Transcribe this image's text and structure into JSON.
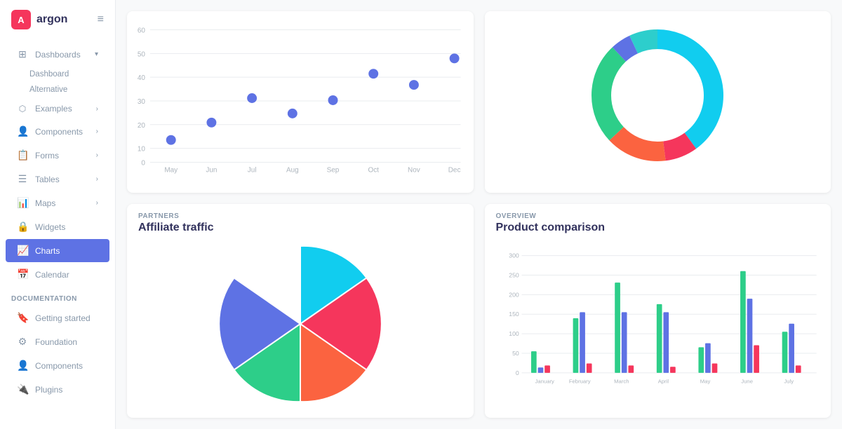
{
  "app": {
    "logo": "A",
    "name": "argon"
  },
  "sidebar": {
    "toggle_icon": "≡",
    "nav_sections": [
      {
        "items": [
          {
            "id": "dashboards",
            "label": "Dashboards",
            "icon": "⊞",
            "has_arrow": true,
            "has_children": true,
            "children": [
              {
                "label": "Dashboard"
              },
              {
                "label": "Alternative"
              }
            ]
          },
          {
            "id": "examples",
            "label": "Examples",
            "icon": "🔲",
            "has_arrow": true
          },
          {
            "id": "components",
            "label": "Components",
            "icon": "👤",
            "has_arrow": true
          },
          {
            "id": "forms",
            "label": "Forms",
            "icon": "📋",
            "has_arrow": true
          },
          {
            "id": "tables",
            "label": "Tables",
            "icon": "☰",
            "has_arrow": true
          },
          {
            "id": "maps",
            "label": "Maps",
            "icon": "📊",
            "has_arrow": true
          },
          {
            "id": "widgets",
            "label": "Widgets",
            "icon": "🔒"
          },
          {
            "id": "charts",
            "label": "Charts",
            "icon": "📅",
            "active": true
          },
          {
            "id": "calendar",
            "label": "Calendar",
            "icon": "📅"
          }
        ]
      }
    ],
    "doc_section": {
      "label": "DOCUMENTATION",
      "items": [
        {
          "id": "getting-started",
          "label": "Getting started",
          "icon": "🔖"
        },
        {
          "id": "foundation",
          "label": "Foundation",
          "icon": "⚙"
        },
        {
          "id": "doc-components",
          "label": "Components",
          "icon": "👤"
        },
        {
          "id": "plugins",
          "label": "Plugins",
          "icon": "🔌"
        }
      ]
    }
  },
  "charts": {
    "scatter": {
      "subtitle": "",
      "title": "",
      "x_labels": [
        "May",
        "Jun",
        "Jul",
        "Aug",
        "Sep",
        "Oct",
        "Nov",
        "Dec"
      ],
      "y_labels": [
        "0",
        "10",
        "20",
        "30",
        "40",
        "50",
        "60"
      ],
      "points": [
        {
          "x": 0,
          "y": 10
        },
        {
          "x": 1,
          "y": 18
        },
        {
          "x": 2,
          "y": 29
        },
        {
          "x": 3,
          "y": 22
        },
        {
          "x": 4,
          "y": 28
        },
        {
          "x": 5,
          "y": 40
        },
        {
          "x": 6,
          "y": 35
        },
        {
          "x": 7,
          "y": 47
        }
      ]
    },
    "donut": {
      "segments": [
        {
          "label": "Cyan",
          "color": "#11cdef",
          "value": 40
        },
        {
          "label": "Red",
          "color": "#f5365c",
          "value": 8
        },
        {
          "label": "Orange",
          "color": "#fb6340",
          "value": 15
        },
        {
          "label": "Green",
          "color": "#2dce89",
          "value": 25
        },
        {
          "label": "Purple",
          "color": "#5e72e4",
          "value": 5
        },
        {
          "label": "Teal",
          "color": "#2dcecc",
          "value": 7
        }
      ]
    },
    "affiliate": {
      "subtitle": "PARTNERS",
      "title": "Affiliate traffic",
      "segments": [
        {
          "label": "Cyan",
          "color": "#11cdef",
          "value": 15
        },
        {
          "label": "Red",
          "color": "#f5365c",
          "value": 25
        },
        {
          "label": "Orange",
          "color": "#fb6340",
          "value": 20
        },
        {
          "label": "Green",
          "color": "#2dce89",
          "value": 15
        },
        {
          "label": "Purple",
          "color": "#5e72e4",
          "value": 25
        }
      ]
    },
    "bar": {
      "subtitle": "OVERVIEW",
      "title": "Product comparison",
      "x_labels": [
        "January",
        "February",
        "March",
        "April",
        "May",
        "June",
        "July"
      ],
      "y_labels": [
        "0",
        "50",
        "100",
        "150",
        "200",
        "250",
        "300"
      ],
      "series": [
        {
          "color": "#2dce89",
          "values": [
            55,
            140,
            230,
            175,
            65,
            260,
            105
          ]
        },
        {
          "color": "#5e72e4",
          "values": [
            15,
            155,
            155,
            155,
            75,
            190,
            125
          ]
        },
        {
          "color": "#f5365c",
          "values": [
            20,
            25,
            20,
            15,
            25,
            70,
            20
          ]
        }
      ]
    }
  }
}
